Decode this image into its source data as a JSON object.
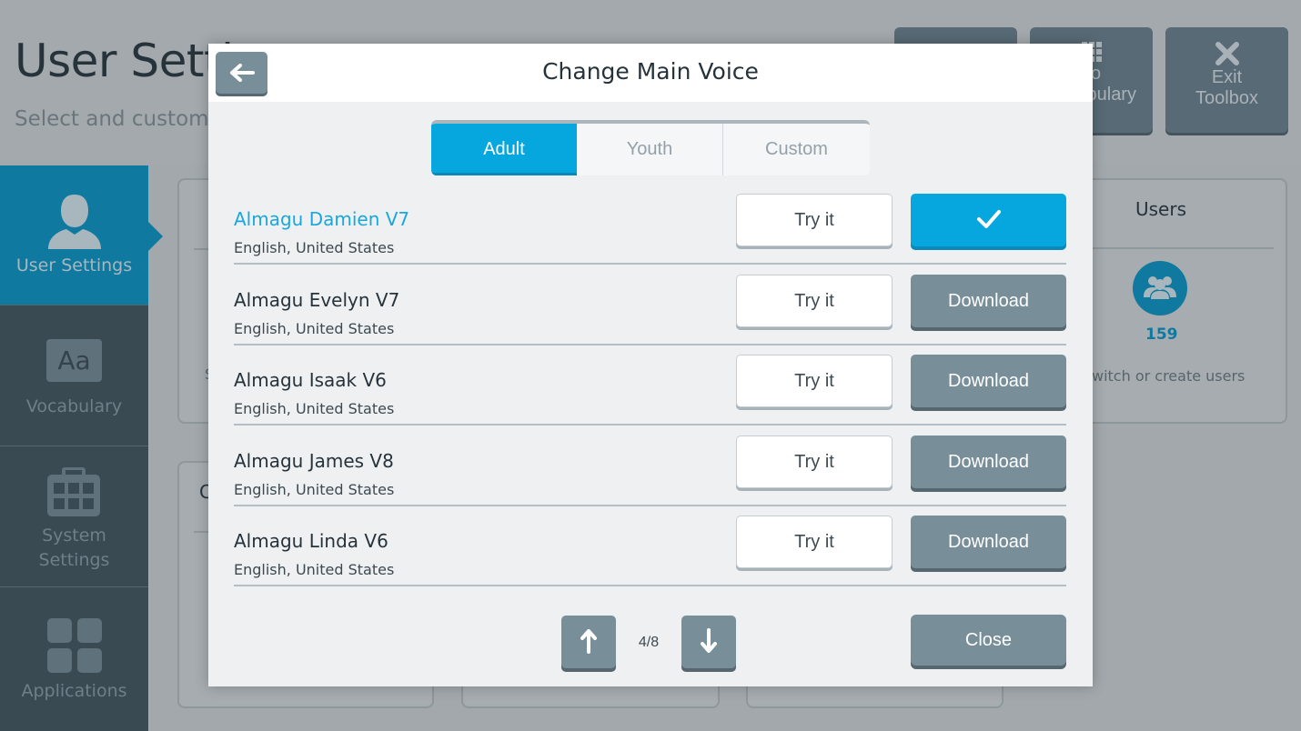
{
  "background": {
    "page_title": "User Settings",
    "page_subtitle": "Select and customize",
    "top_buttons": [
      {
        "icon": "grid-icon",
        "label_line1": "To",
        "label_line2": "Vocabulary",
        "visible_label_line1": "To",
        "visible_label_line2": "bulary"
      },
      {
        "icon": "close-icon",
        "label_line1": "Exit",
        "label_line2": "Toolbox"
      }
    ],
    "sidebar": {
      "items": [
        {
          "label": "User Settings",
          "icon": "user-icon",
          "active": true
        },
        {
          "label": "Vocabulary",
          "icon": "vocabulary-aa-icon",
          "icon_text": "Aa",
          "active": false
        },
        {
          "label_line1": "System",
          "label_line2": "Settings",
          "icon": "toolbox-icon",
          "active": false
        },
        {
          "label": "Applications",
          "icon": "apps-grid-icon",
          "active": false
        }
      ]
    },
    "users_card": {
      "title": "Users",
      "count": "159",
      "description": "witch or create users"
    },
    "partial_texts": {
      "card_left_letter": "S",
      "card_bottom_letter": "C"
    }
  },
  "modal": {
    "title": "Change Main Voice",
    "back_icon": "arrow-left-icon",
    "tabs": [
      {
        "label": "Adult",
        "active": true
      },
      {
        "label": "Youth",
        "active": false
      },
      {
        "label": "Custom",
        "active": false
      }
    ],
    "voices": [
      {
        "name": "Almagu Damien V7",
        "language": "English, United States",
        "try_label": "Try it",
        "action": "selected",
        "action_label": ""
      },
      {
        "name": "Almagu Evelyn V7",
        "language": "English, United States",
        "try_label": "Try it",
        "action": "download",
        "action_label": "Download"
      },
      {
        "name": "Almagu Isaak V6",
        "language": "English, United States",
        "try_label": "Try it",
        "action": "download",
        "action_label": "Download"
      },
      {
        "name": "Almagu James V8",
        "language": "English, United States",
        "try_label": "Try it",
        "action": "download",
        "action_label": "Download"
      },
      {
        "name": "Almagu Linda V6",
        "language": "English, United States",
        "try_label": "Try it",
        "action": "download",
        "action_label": "Download"
      }
    ],
    "pagination": {
      "current": 4,
      "total": 8,
      "label": "4/8"
    },
    "close_label": "Close"
  },
  "colors": {
    "accent": "#05a7de",
    "sidebar_active": "#10799f",
    "sidebar_bg": "#3a4a53",
    "button_gray": "#788e99",
    "modal_bg": "#eef0f2"
  }
}
